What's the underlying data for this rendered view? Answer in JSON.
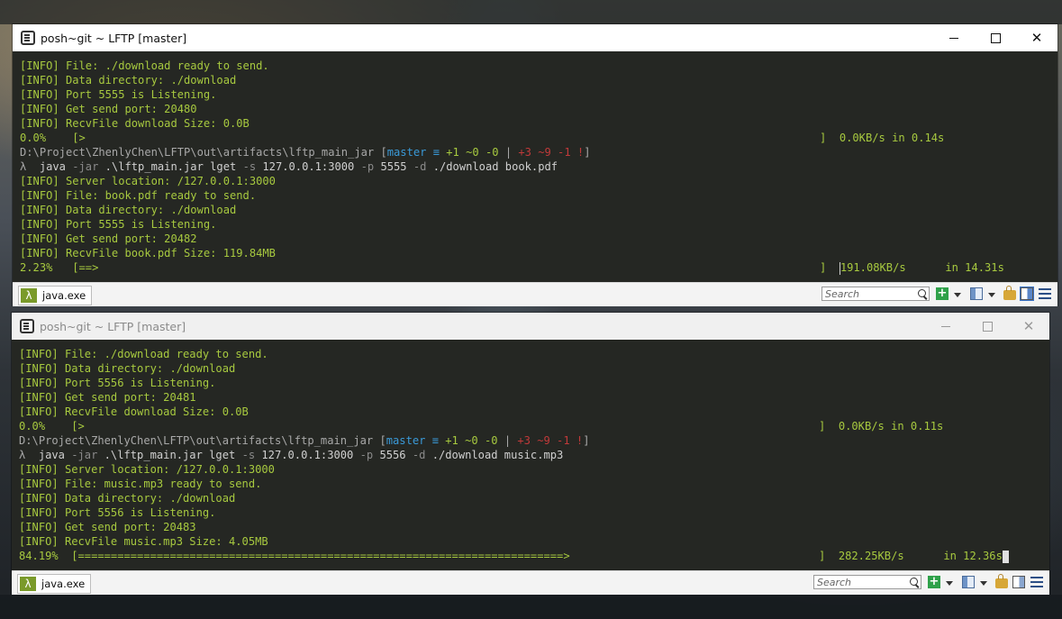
{
  "window1": {
    "title": "posh~git ~ LFTP [master]",
    "controls": {
      "minimize": "—",
      "maximize": "□",
      "close": "✕"
    },
    "tab_label": "java.exe",
    "search_placeholder": "Search",
    "lines": [
      {
        "t": "[INFO] File: ./download ready to send."
      },
      {
        "t": "[INFO] Data directory: ./download"
      },
      {
        "t": "[INFO] Port 5555 is Listening."
      },
      {
        "t": "[INFO] Get send port: 20480"
      },
      {
        "t": "[INFO] RecvFile download Size: 0.0B"
      },
      {
        "progress": {
          "pct": "0.0%",
          "bar": "[>",
          "end": "]",
          "speed": "0.0KB/s in 0.14s"
        }
      },
      {
        "prompt": {
          "path": "D:\\Project\\ZhenlyChen\\LFTP\\out\\artifacts\\lftp_main_jar",
          "branch": "master",
          "sym": "≡",
          "staged": "+1 ~0 -0",
          "sep": "|",
          "unstaged": "+3 ~9 -1 !"
        }
      },
      {
        "cmd": {
          "lambda": "λ",
          "exe": "java",
          "f1": "-jar",
          "jar": ".\\lftp_main.jar lget",
          "f2": "-s",
          "addr": "127.0.0.1:3000",
          "f3": "-p",
          "port": "5555",
          "f4": "-d",
          "rest": "./download book.pdf"
        }
      },
      {
        "t": "[INFO] Server location: /127.0.0.1:3000"
      },
      {
        "t": "[INFO] File: book.pdf ready to send."
      },
      {
        "t": "[INFO] Data directory: ./download"
      },
      {
        "t": "[INFO] Port 5555 is Listening."
      },
      {
        "t": "[INFO] Get send port: 20482"
      },
      {
        "t": "[INFO] RecvFile book.pdf Size: 119.84MB"
      },
      {
        "progress": {
          "pct": "2.23%",
          "bar": "[==>",
          "end": "]",
          "speed": "191.08KB/s",
          "time": "in 14.31s"
        }
      }
    ]
  },
  "window2": {
    "title": "posh~git ~ LFTP [master]",
    "controls": {
      "minimize": "—",
      "maximize": "□",
      "close": "✕"
    },
    "tab_label": "java.exe",
    "search_placeholder": "Search",
    "lines": [
      {
        "t": "[INFO] File: ./download ready to send."
      },
      {
        "t": "[INFO] Data directory: ./download"
      },
      {
        "t": "[INFO] Port 5556 is Listening."
      },
      {
        "t": "[INFO] Get send port: 20481"
      },
      {
        "t": "[INFO] RecvFile download Size: 0.0B"
      },
      {
        "progress": {
          "pct": "0.0%",
          "bar": "[>",
          "end": "]",
          "speed": "0.0KB/s in 0.11s"
        }
      },
      {
        "prompt": {
          "path": "D:\\Project\\ZhenlyChen\\LFTP\\out\\artifacts\\lftp_main_jar",
          "branch": "master",
          "sym": "≡",
          "staged": "+1 ~0 -0",
          "sep": "|",
          "unstaged": "+3 ~9 -1 !"
        }
      },
      {
        "cmd": {
          "lambda": "λ",
          "exe": "java",
          "f1": "-jar",
          "jar": ".\\lftp_main.jar lget",
          "f2": "-s",
          "addr": "127.0.0.1:3000",
          "f3": "-p",
          "port": "5556",
          "f4": "-d",
          "rest": "./download music.mp3"
        }
      },
      {
        "t": "[INFO] Server location: /127.0.0.1:3000"
      },
      {
        "t": "[INFO] File: music.mp3 ready to send."
      },
      {
        "t": "[INFO] Data directory: ./download"
      },
      {
        "t": "[INFO] Port 5556 is Listening."
      },
      {
        "t": "[INFO] Get send port: 20483"
      },
      {
        "t": "[INFO] RecvFile music.mp3 Size: 4.05MB"
      },
      {
        "progress": {
          "pct": "84.19%",
          "bar": "[==========================================================================>",
          "end": "]",
          "speed": "282.25KB/s",
          "time": "in 12.36s"
        }
      }
    ]
  }
}
